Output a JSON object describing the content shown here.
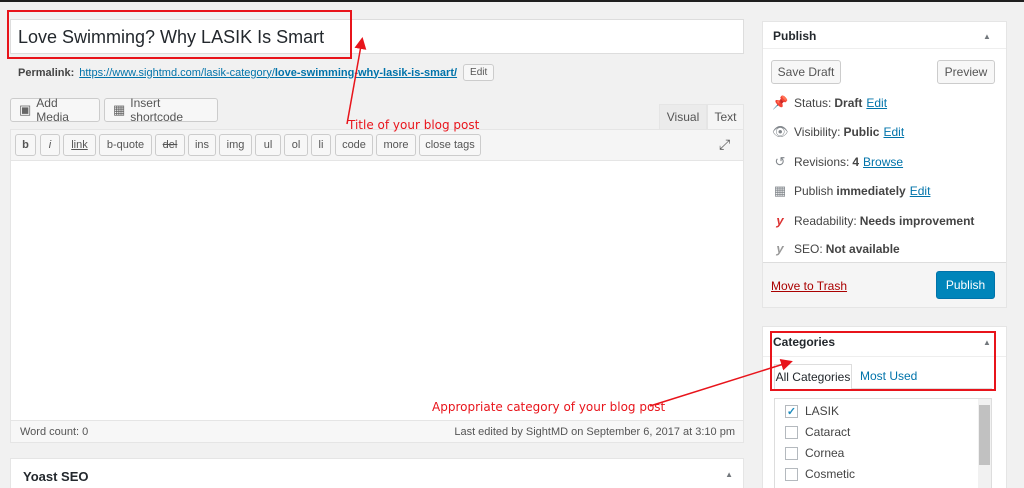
{
  "post": {
    "title": "Love Swimming? Why LASIK Is Smart",
    "permalink_label": "Permalink:",
    "permalink_base": "https://www.sightmd.com/lasik-category/",
    "permalink_slug": "love-swimming-why-lasik-is-smart/",
    "permalink_edit": "Edit"
  },
  "media": {
    "add_media": "Add Media",
    "insert_shortcode": "Insert shortcode"
  },
  "editor_tabs": {
    "visual": "Visual",
    "text": "Text"
  },
  "quicktags": [
    "b",
    "i",
    "link",
    "b-quote",
    "del",
    "ins",
    "img",
    "ul",
    "ol",
    "li",
    "code",
    "more",
    "close tags"
  ],
  "status_bar": {
    "word_count": "Word count: 0",
    "last_edited": "Last edited by SightMD on September 6, 2017 at 3:10 pm"
  },
  "yoast": {
    "title": "Yoast SEO"
  },
  "publish": {
    "title": "Publish",
    "save_draft": "Save Draft",
    "preview": "Preview",
    "status_label": "Status:",
    "status_value": "Draft",
    "visibility_label": "Visibility:",
    "visibility_value": "Public",
    "revisions_label": "Revisions:",
    "revisions_value": "4",
    "browse": "Browse",
    "publish_label": "Publish",
    "publish_value": "immediately",
    "edit": "Edit",
    "readability_label": "Readability:",
    "readability_value": "Needs improvement",
    "seo_label": "SEO:",
    "seo_value": "Not available",
    "move_to_trash": "Move to Trash",
    "publish_button": "Publish"
  },
  "categories": {
    "title": "Categories",
    "tab_all": "All Categories",
    "tab_most_used": "Most Used",
    "items": [
      {
        "label": "LASIK",
        "checked": true
      },
      {
        "label": "Cataract",
        "checked": false
      },
      {
        "label": "Cornea",
        "checked": false
      },
      {
        "label": "Cosmetic",
        "checked": false
      }
    ]
  },
  "annotations": {
    "title_note": "Title of your blog post",
    "category_note": "Appropriate category of your blog post"
  },
  "colors": {
    "annotation_red": "#e8141b",
    "link_blue": "#0073aa",
    "primary_blue": "#0085ba",
    "trash_red": "#a00"
  }
}
